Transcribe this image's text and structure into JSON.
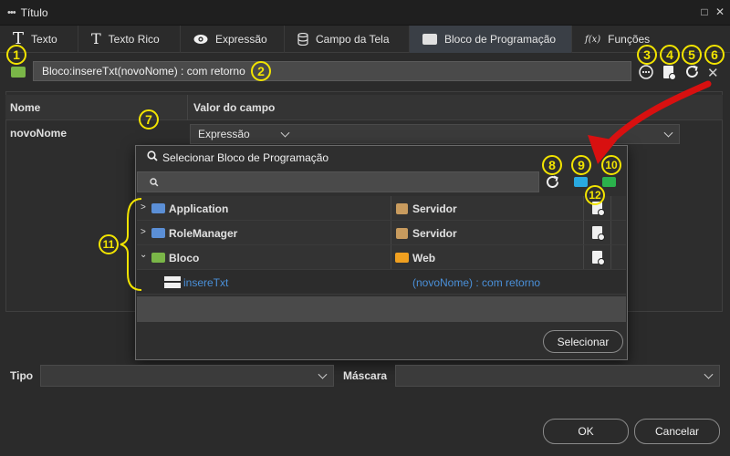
{
  "window": {
    "title": "Título",
    "menu_dots": "•••",
    "maximize": "□",
    "close": "✕"
  },
  "tabs": [
    {
      "label": "Texto",
      "icon": "text-icon"
    },
    {
      "label": "Texto Rico",
      "icon": "rich-text-icon"
    },
    {
      "label": "Expressão",
      "icon": "eye-icon"
    },
    {
      "label": "Campo da Tela",
      "icon": "database-icon"
    },
    {
      "label": "Bloco de Programação",
      "icon": "block-icon",
      "active": true
    },
    {
      "label": "Funções",
      "icon": "function-icon"
    }
  ],
  "toolbar": {
    "block_value": "Bloco:insereTxt(novoNome) : com retorno"
  },
  "grid": {
    "headers": [
      "Nome",
      "Valor do campo"
    ],
    "rows": [
      {
        "name": "novoNome",
        "value": "Expressão"
      }
    ]
  },
  "popup": {
    "title": "Selecionar Bloco de Programação",
    "search_placeholder": "",
    "rows": [
      {
        "name": "Application",
        "type": "Servidor",
        "expanded": false
      },
      {
        "name": "RoleManager",
        "type": "Servidor",
        "expanded": false
      },
      {
        "name": "Bloco",
        "type": "Web",
        "expanded": true
      }
    ],
    "child": {
      "name": "insereTxt",
      "signature": "(novoNome) : com retorno"
    },
    "select_button": "Selecionar"
  },
  "footer": {
    "tipo_label": "Tipo",
    "tipo_value": "",
    "mascara_label": "Máscara",
    "mascara_value": "",
    "ok": "OK",
    "cancel": "Cancelar"
  },
  "annotations": [
    "1",
    "2",
    "3",
    "4",
    "5",
    "6",
    "7",
    "8",
    "9",
    "10",
    "11",
    "12"
  ],
  "colors": {
    "accent_blue": "#4a90d9",
    "folder_blue": "#5b8fd6",
    "folder_green": "#7ab648",
    "folder_orange": "#f0a020",
    "annotation_yellow": "#f2e400",
    "arrow_red": "#d81010"
  }
}
